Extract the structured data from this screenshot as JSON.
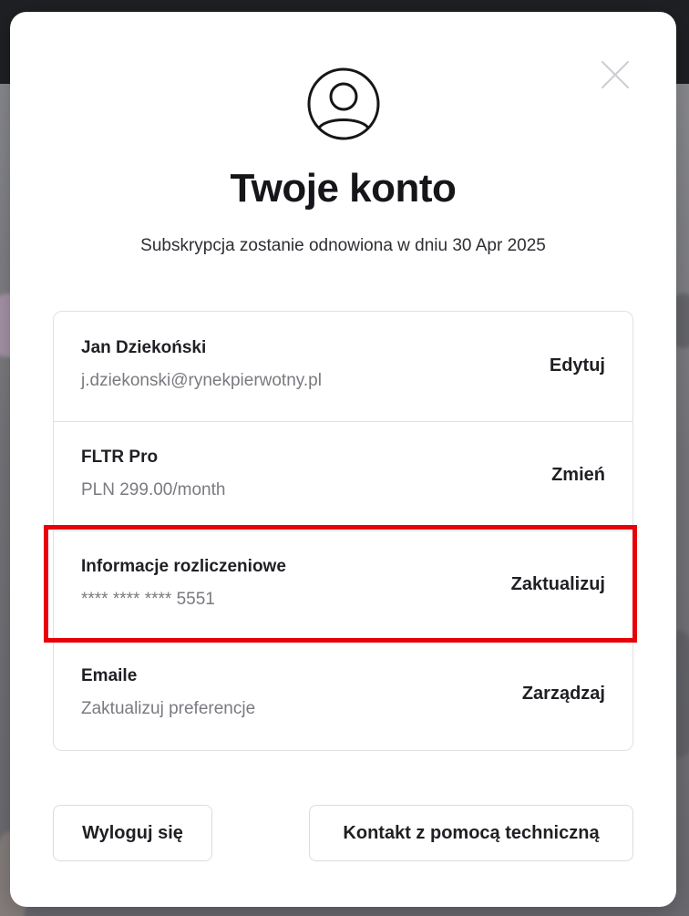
{
  "modal": {
    "title": "Twoje konto",
    "subtitle": "Subskrypcja zostanie odnowiona w dniu 30 Apr 2025",
    "close_icon": "close-icon",
    "avatar_icon": "user-circle-icon"
  },
  "rows": [
    {
      "title": "Jan Dziekoński",
      "subtitle": "j.dziekonski@rynekpierwotny.pl",
      "action": "Edytuj"
    },
    {
      "title": "FLTR Pro",
      "subtitle": "PLN 299.00/month",
      "action": "Zmień"
    },
    {
      "title": "Informacje rozliczeniowe",
      "subtitle": "**** **** **** 5551",
      "action": "Zaktualizuj"
    },
    {
      "title": "Emaile",
      "subtitle": "Zaktualizuj preferencje",
      "action": "Zarządzaj"
    }
  ],
  "buttons": {
    "logout": "Wyloguj się",
    "support": "Kontakt z pomocą techniczną"
  },
  "colors": {
    "highlight": "#e8000b",
    "text_primary": "#1f1f24",
    "text_secondary": "#7a7a80",
    "border": "#e1e1e4"
  }
}
